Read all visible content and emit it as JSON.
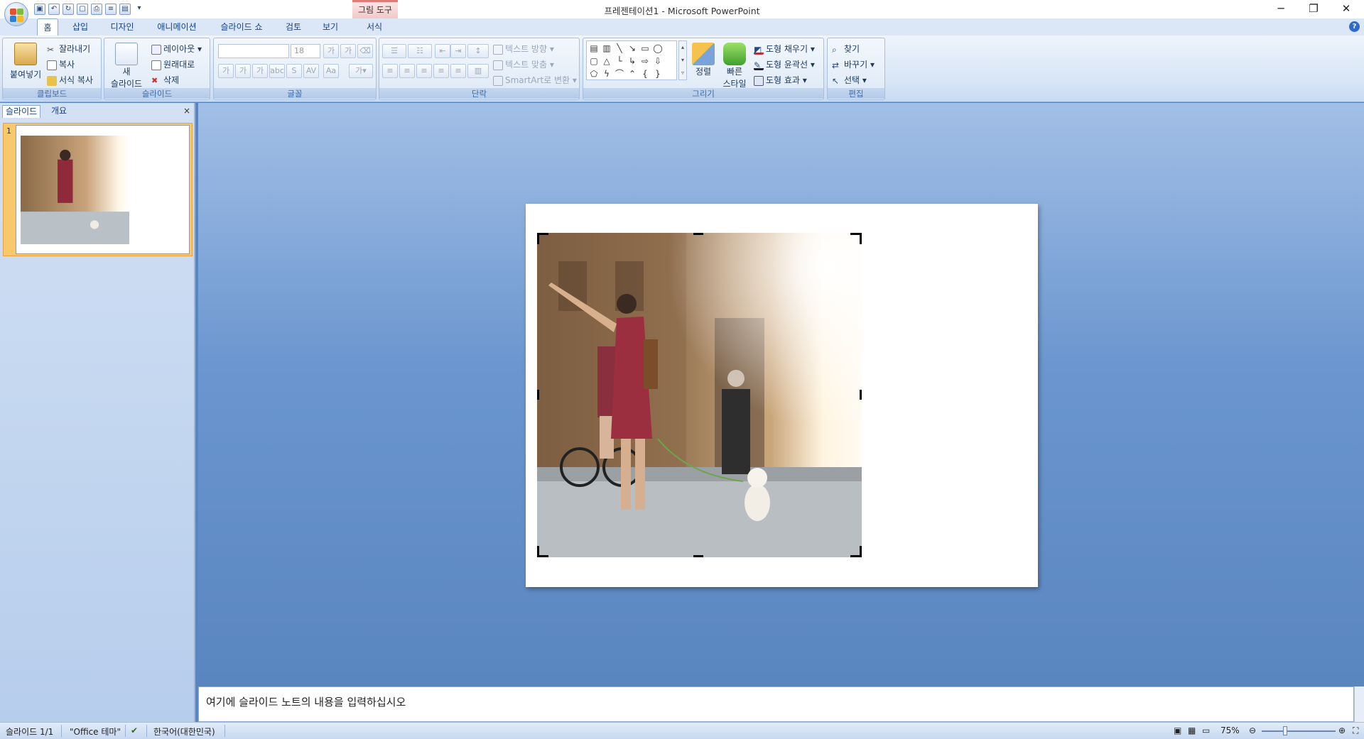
{
  "window": {
    "title": "프레젠테이션1 - Microsoft PowerPoint",
    "context_tool_label": "그림 도구",
    "controls": [
      "minimize-icon",
      "restore-icon",
      "close-icon"
    ]
  },
  "tabs": [
    "홈",
    "삽입",
    "디자인",
    "애니메이션",
    "슬라이드 쇼",
    "검토",
    "보기",
    "서식"
  ],
  "active_tab": "홈",
  "ribbon": {
    "clipboard": {
      "label": "클립보드",
      "paste": "붙여넣기",
      "cut": "잘라내기",
      "copy": "복사",
      "format_painter": "서식 복사"
    },
    "slides": {
      "label": "슬라이드",
      "new_slide_1": "새",
      "new_slide_2": "슬라이드",
      "layout": "레이아웃",
      "reset": "원래대로",
      "delete": "삭제"
    },
    "font": {
      "label": "글꼴",
      "font_name": "",
      "font_size": "18"
    },
    "paragraph": {
      "label": "단락",
      "text_direction": "텍스트 방향",
      "align_text": "텍스트 맞춤",
      "smartart": "SmartArt로 변환"
    },
    "drawing": {
      "label": "그리기",
      "arrange": "정렬",
      "quick_styles_1": "빠른",
      "quick_styles_2": "스타일",
      "shape_fill": "도형 채우기",
      "shape_outline": "도형 윤곽선",
      "shape_effects": "도형 효과"
    },
    "editing": {
      "label": "편집",
      "find": "찾기",
      "replace": "바꾸기",
      "select": "선택"
    }
  },
  "left_pane": {
    "tabs": [
      "슬라이드",
      "개요"
    ],
    "close": "×",
    "slide_number": "1"
  },
  "notes": {
    "placeholder": "여기에 슬라이드 노트의 내용을 입력하십시오"
  },
  "status": {
    "slide_info": "슬라이드 1/1",
    "theme": "\"Office 테마\"",
    "language": "한국어(대한민국)",
    "zoom": "75%"
  },
  "colors": {
    "accent": "#15428b",
    "selection": "#f9c86a",
    "background": "#5a86c0"
  }
}
